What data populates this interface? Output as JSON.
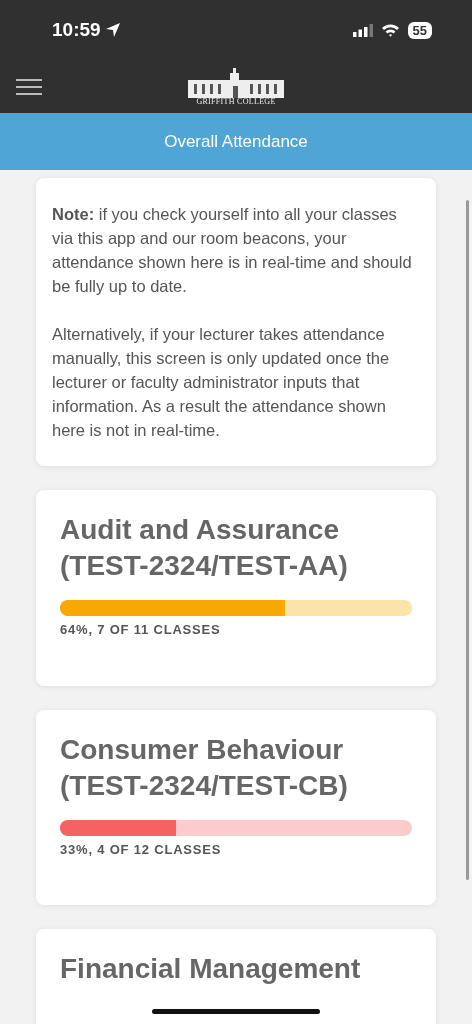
{
  "status_bar": {
    "time": "10:59",
    "battery": "55"
  },
  "header": {
    "logo_text": "GRIFFITH COLLEGE"
  },
  "title_bar": {
    "title": "Overall Attendance"
  },
  "note": {
    "paragraphs": [
      "**Note:** if you check yourself into all your classes via this app and our room beacons, your attendance shown here is in real-time and should be fully up to date.",
      "Alternatively, if your lecturer takes attendance manually, this screen is only updated once the lecturer or faculty administrator inputs that information. As a result the attendance shown here is not in real-time."
    ]
  },
  "courses": [
    {
      "name": "Audit and Assurance (TEST-2324/TEST-AA)",
      "level": 0.64,
      "color": "#f8a900",
      "summary": "64%, 7 OF 11 CLASSES"
    },
    {
      "name": "Consumer Behaviour (TEST-2324/TEST-CB)",
      "level": 0.33,
      "color": "#f56262",
      "summary": "33%, 4 OF 12 CLASSES"
    },
    {
      "name": "Financial Management"
    }
  ]
}
